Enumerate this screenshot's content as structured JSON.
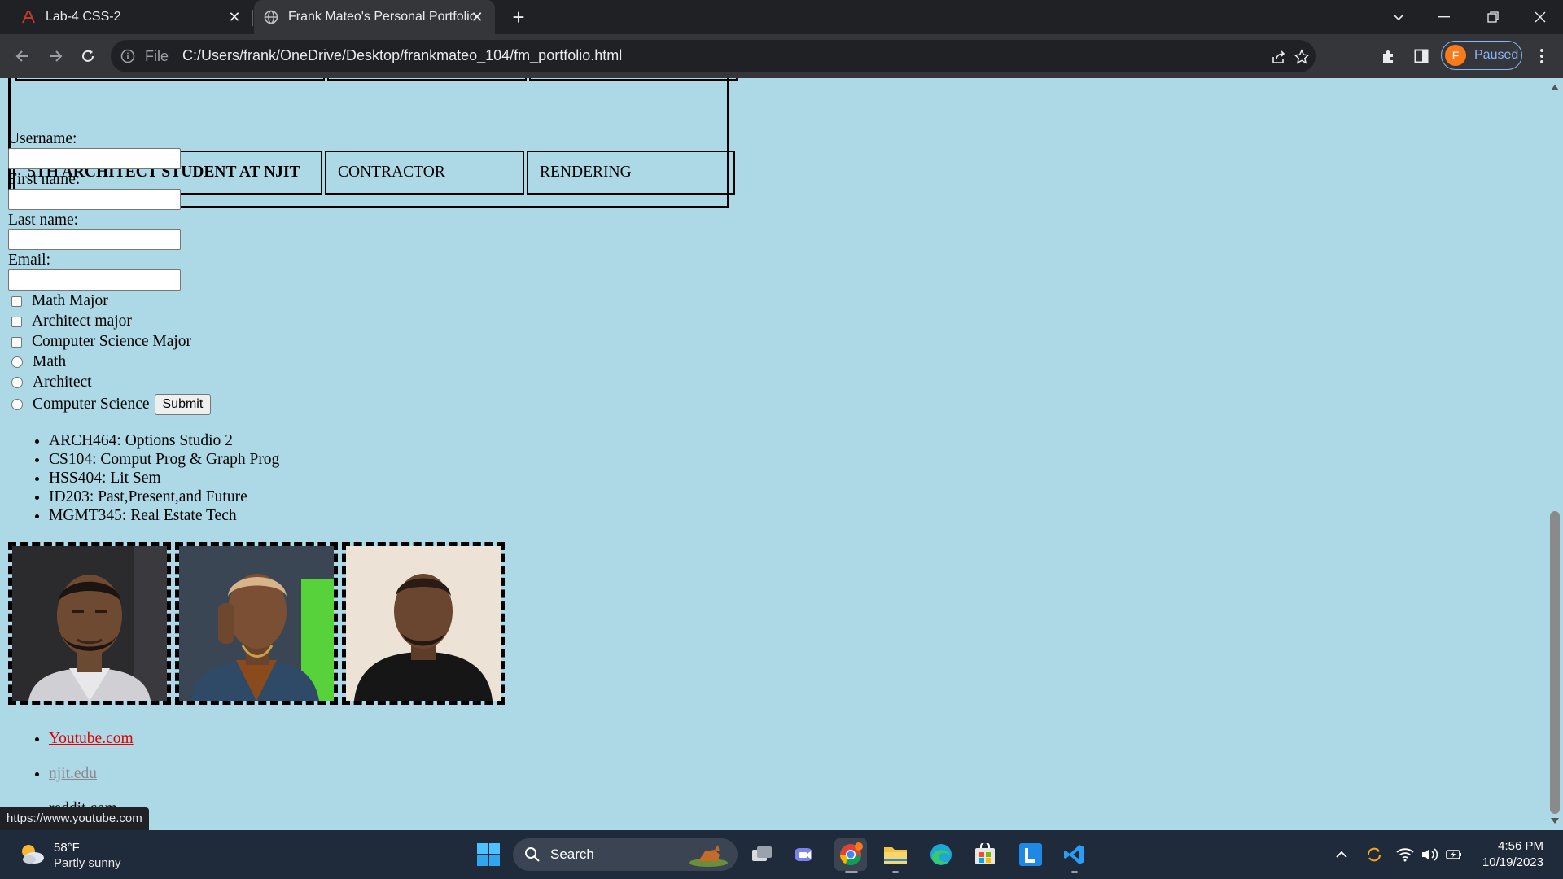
{
  "browser": {
    "tabs": [
      {
        "title": "Lab-4 CSS-2",
        "icon": "lab-favicon-icon",
        "active": false
      },
      {
        "title": "Frank Mateo's Personal Portfolio",
        "icon": "globe-icon",
        "active": true
      }
    ],
    "address": {
      "scheme_label": "File",
      "url": "C:/Users/frank/OneDrive/Desktop/frankmateo_104/fm_portfolio.html"
    },
    "profile": {
      "initial": "F",
      "status": "Paused"
    },
    "accent": "#8ab4f8"
  },
  "page": {
    "background": "#add8e6",
    "table_row": [
      "5TH ARCHITECT STUDENT AT NJIT",
      "CONTRACTOR",
      "RENDERING"
    ],
    "form": {
      "fields": [
        "Username:",
        "First name:",
        "Last name:",
        "Email:"
      ],
      "checkboxes": [
        "Math Major",
        "Architect major",
        "Computer Science Major"
      ],
      "radios": [
        "Math",
        "Architect",
        "Computer Science"
      ],
      "submit_label": "Submit"
    },
    "courses": [
      "ARCH464: Options Studio 2",
      "CS104: Comput Prog & Graph Prog",
      "HSS404: Lit Sem",
      "ID203: Past,Present,and Future",
      "MGMT345: Real Estate Tech"
    ],
    "photos": [
      "portrait-photo-1",
      "portrait-photo-2",
      "portrait-photo-3"
    ],
    "links": [
      "Youtube.com",
      "njit.edu",
      "reddit.com"
    ],
    "status_url": "https://www.youtube.com"
  },
  "taskbar": {
    "weather": {
      "temp": "58°F",
      "desc": "Partly sunny"
    },
    "search_label": "Search",
    "clock": {
      "time": "4:56 PM",
      "date": "10/19/2023"
    }
  }
}
